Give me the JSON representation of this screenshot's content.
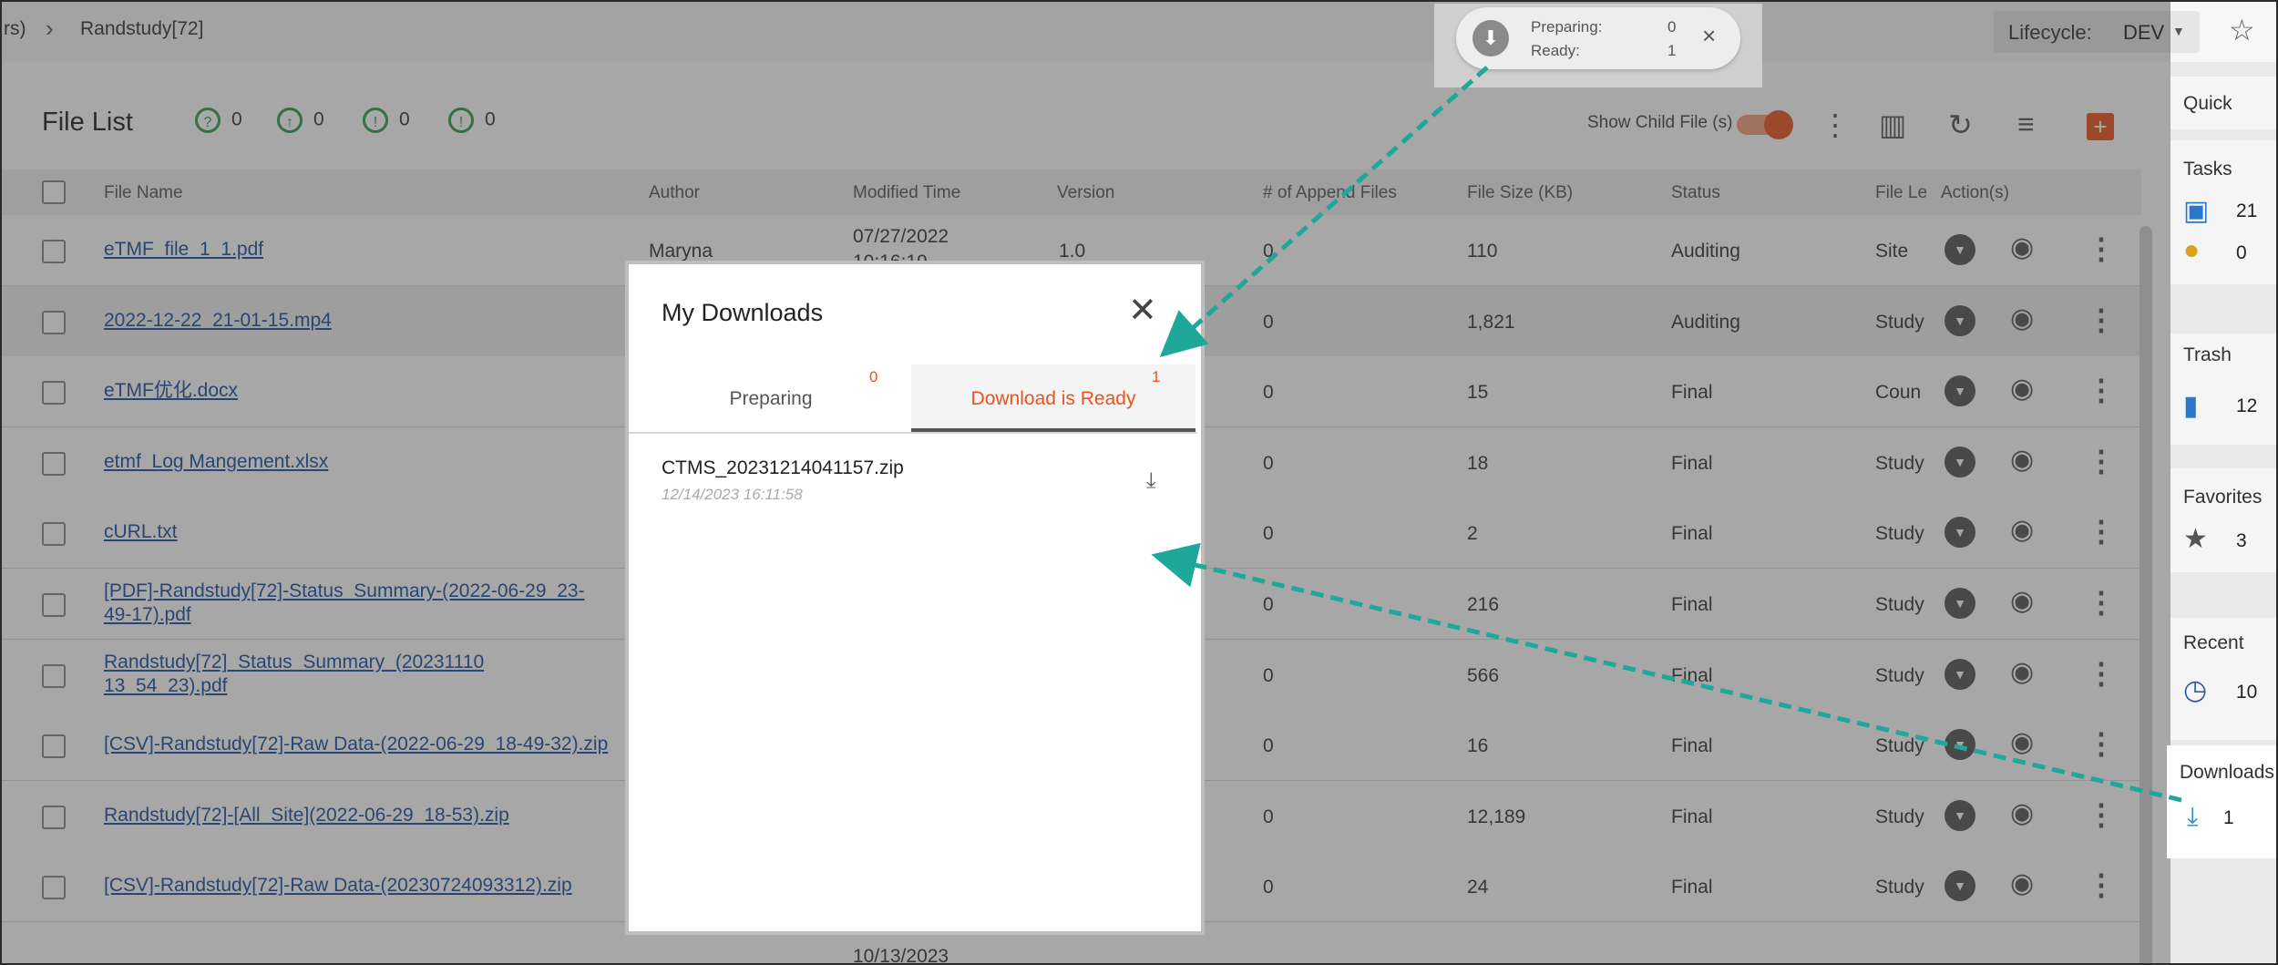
{
  "topbar": {
    "breadcrumb_prev": "rs)",
    "breadcrumb_sep": "›",
    "breadcrumb_current": "Randstudy[72]",
    "lifecycle_label": "Lifecycle:",
    "lifecycle_value": "DEV"
  },
  "toast": {
    "preparing_label": "Preparing:",
    "preparing_count": "0",
    "ready_label": "Ready:",
    "ready_count": "1"
  },
  "file_list": {
    "title": "File List",
    "badges": [
      "0",
      "0",
      "0",
      "0"
    ],
    "show_child_label": "Show Child File (s)",
    "columns": [
      "File Name",
      "Author",
      "Modified Time",
      "Version",
      "# of Append Files",
      "File Size (KB)",
      "Status",
      "File Le",
      "Action(s)"
    ],
    "rows": [
      {
        "name": "eTMF_file_1_1.pdf",
        "author": "Maryna",
        "modified": "07/27/2022",
        "modified2": "10:16:19",
        "version": "1.0",
        "append": "0",
        "size": "110",
        "status": "Auditing",
        "level": "Site"
      },
      {
        "name": "2022-12-22_21-01-15.mp4",
        "append": "0",
        "size": "1,821",
        "status": "Auditing",
        "level": "Study"
      },
      {
        "name": "eTMF优化.docx",
        "append": "0",
        "size": "15",
        "status": "Final",
        "level": "Coun"
      },
      {
        "name": "etmf_Log Mangement.xlsx",
        "append": "0",
        "size": "18",
        "status": "Final",
        "level": "Study"
      },
      {
        "name": "cURL.txt",
        "append": "0",
        "size": "2",
        "status": "Final",
        "level": "Study"
      },
      {
        "name": "[PDF]-Randstudy[72]-Status_Summary-(2022-06-29_23-",
        "name2": "49-17).pdf",
        "append": "0",
        "size": "216",
        "status": "Final",
        "level": "Study"
      },
      {
        "name": "Randstudy[72]_Status_Summary_(20231110",
        "name2": "13_54_23).pdf",
        "append": "0",
        "size": "566",
        "status": "Final",
        "level": "Study"
      },
      {
        "name": "[CSV]-Randstudy[72]-Raw Data-(2022-06-29_18-49-32).zip",
        "append": "0",
        "size": "16",
        "status": "Final",
        "level": "Study"
      },
      {
        "name": "Randstudy[72]-[All_Site](2022-06-29_18-53).zip",
        "append": "0",
        "size": "12,189",
        "status": "Final",
        "level": "Study"
      },
      {
        "name": "[CSV]-Randstudy[72]-Raw Data-(20230724093312).zip",
        "append": "0",
        "size": "24",
        "status": "Final",
        "level": "Study"
      }
    ],
    "last_row_modified": "10/13/2023"
  },
  "right_panel": {
    "quick": "Quick",
    "tasks": "Tasks",
    "tasks_count": "21",
    "questions_count": "0",
    "trash": "Trash",
    "trash_count": "12",
    "favorites": "Favorites",
    "favorites_count": "3",
    "recent": "Recent",
    "recent_count": "10",
    "downloads": "Downloads",
    "downloads_count": "1"
  },
  "modal": {
    "title": "My Downloads",
    "tab_preparing": "Preparing",
    "tab_preparing_count": "0",
    "tab_ready": "Download is Ready",
    "tab_ready_count": "1",
    "file_name": "CTMS_20231214041157.zip",
    "file_time": "12/14/2023 16:11:58"
  },
  "colors": {
    "accent": "#e9541c",
    "link": "#1a4fa0",
    "arrow": "#1fa89a"
  }
}
